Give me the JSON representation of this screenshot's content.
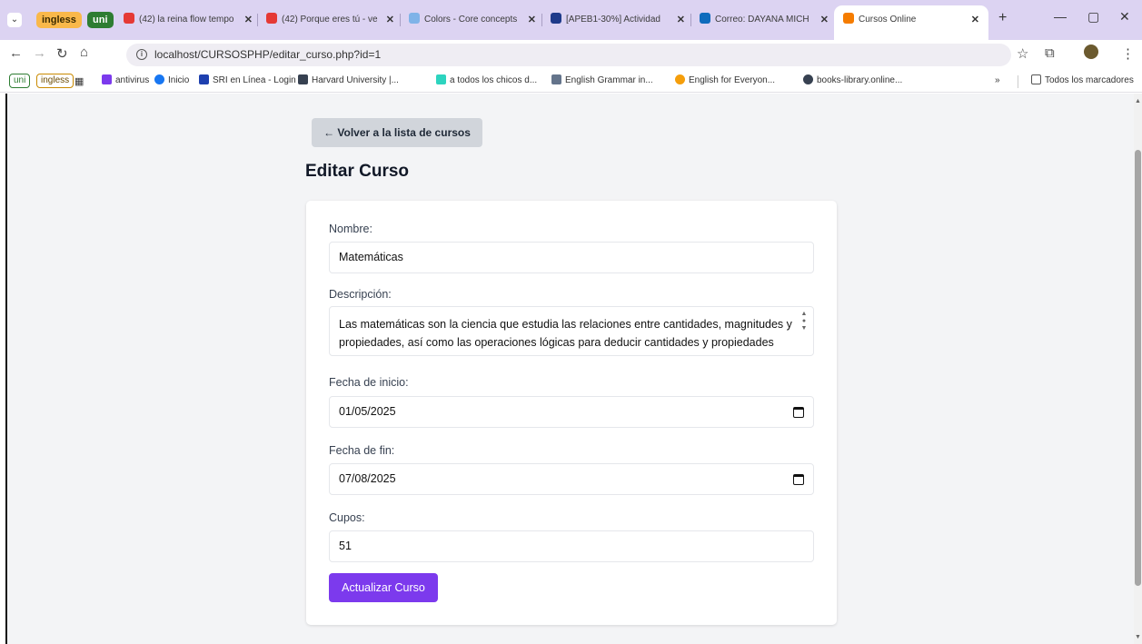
{
  "browser": {
    "tab_groups": [
      {
        "label": "ingless",
        "color": "#f9b84a"
      },
      {
        "label": "uni",
        "color": "#2e7d32"
      }
    ],
    "tabs": [
      {
        "title": "(42) la reina flow tempo",
        "icon": "youtube-icon"
      },
      {
        "title": "(42) Porque eres tú - ve",
        "icon": "youtube-icon"
      },
      {
        "title": "Colors - Core concepts",
        "icon": "colors-icon"
      },
      {
        "title": "[APEB1-30%] Actividad",
        "icon": "u-icon"
      },
      {
        "title": "Correo: DAYANA MICH",
        "icon": "outlook-icon"
      },
      {
        "title": "Cursos Online",
        "icon": "xampp-icon",
        "active": true
      }
    ],
    "url": "localhost/CURSOSPHP/editar_curso.php?id=1",
    "bookmarks": [
      {
        "label": "antivirus",
        "icon": "antivirus-icon"
      },
      {
        "label": "Inicio",
        "icon": "facebook-icon"
      },
      {
        "label": "SRI en Línea - Login",
        "icon": "sri-icon"
      },
      {
        "label": "Harvard University |...",
        "icon": "harvard-icon"
      },
      {
        "label": "a todos los chicos d...",
        "icon": "book-icon"
      },
      {
        "label": "English Grammar in...",
        "icon": "grammar-icon"
      },
      {
        "label": "English for Everyon...",
        "icon": "english-icon"
      },
      {
        "label": "books-library.online...",
        "icon": "globe-icon"
      }
    ],
    "bookmark_chips": [
      "uni",
      "ingless"
    ],
    "all_bookmarks_label": "Todos los marcadores"
  },
  "page": {
    "back_label": "← Volver a la lista de cursos",
    "title": "Editar Curso",
    "form": {
      "name_label": "Nombre:",
      "name_value": "Matemáticas",
      "description_label": "Descripción:",
      "description_value": "Las matemáticas son la ciencia que estudia las relaciones entre cantidades, magnitudes y propiedades, así como las operaciones lógicas para deducir cantidades y propiedades",
      "start_label": "Fecha de inicio:",
      "start_value": "01/05/2025",
      "end_label": "Fecha de fin:",
      "end_value": "07/08/2025",
      "seats_label": "Cupos:",
      "seats_value": "51",
      "submit_label": "Actualizar Curso"
    }
  },
  "colors": {
    "accent": "#7c3aed",
    "page_bg": "#f3f4f6",
    "tabstrip_bg": "#dcd3f2"
  }
}
